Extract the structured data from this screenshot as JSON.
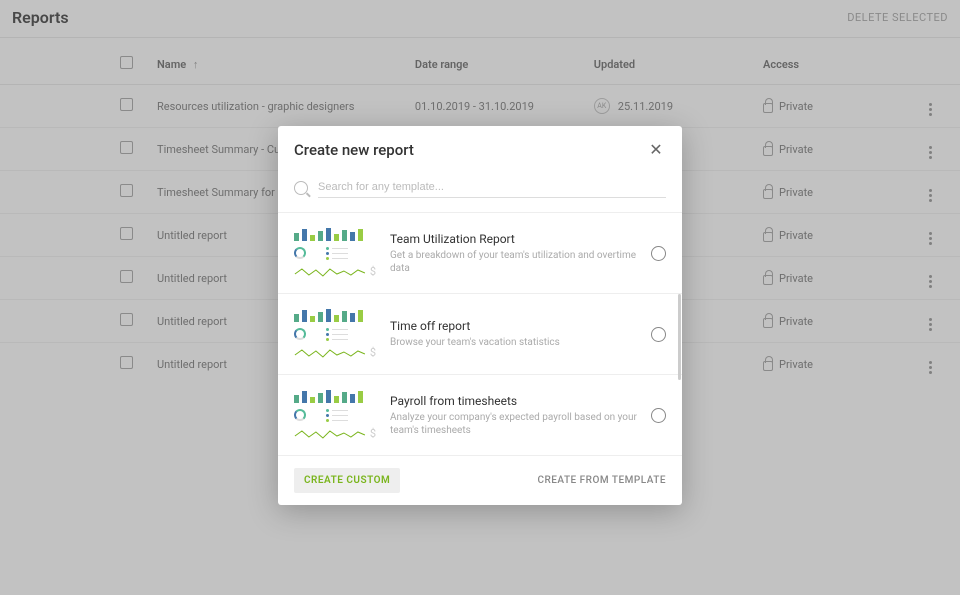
{
  "header": {
    "title": "Reports",
    "delete_label": "DELETE SELECTED"
  },
  "table": {
    "columns": {
      "name": "Name",
      "date": "Date range",
      "updated": "Updated",
      "access": "Access"
    },
    "rows": [
      {
        "name": "Resources utilization - graphic designers",
        "date": "01.10.2019 - 31.10.2019",
        "updated": "25.11.2019",
        "avatar": "AK",
        "access": "Private"
      },
      {
        "name": "Timesheet Summary - Current Month",
        "date": "",
        "updated": "",
        "avatar": "",
        "access": "Private"
      },
      {
        "name": "Timesheet Summary for Sea Hotels b",
        "date": "",
        "updated": "",
        "avatar": "",
        "access": "Private"
      },
      {
        "name": "Untitled report",
        "date": "",
        "updated": "",
        "avatar": "",
        "access": "Private"
      },
      {
        "name": "Untitled report",
        "date": "",
        "updated": "",
        "avatar": "",
        "access": "Private"
      },
      {
        "name": "Untitled report",
        "date": "",
        "updated": "",
        "avatar": "",
        "access": "Private"
      },
      {
        "name": "Untitled report",
        "date": "",
        "updated": "",
        "avatar": "",
        "access": "Private"
      }
    ]
  },
  "modal": {
    "title": "Create new report",
    "search_placeholder": "Search for any template...",
    "templates": [
      {
        "title": "Team Utilization Report",
        "desc": "Get a breakdown of your team's utilization and overtime data"
      },
      {
        "title": "Time off report",
        "desc": "Browse your team's vacation statistics"
      },
      {
        "title": "Payroll from timesheets",
        "desc": "Analyze your company's expected payroll based on your team's timesheets"
      }
    ],
    "create_custom_label": "CREATE CUSTOM",
    "create_template_label": "CREATE FROM TEMPLATE"
  }
}
